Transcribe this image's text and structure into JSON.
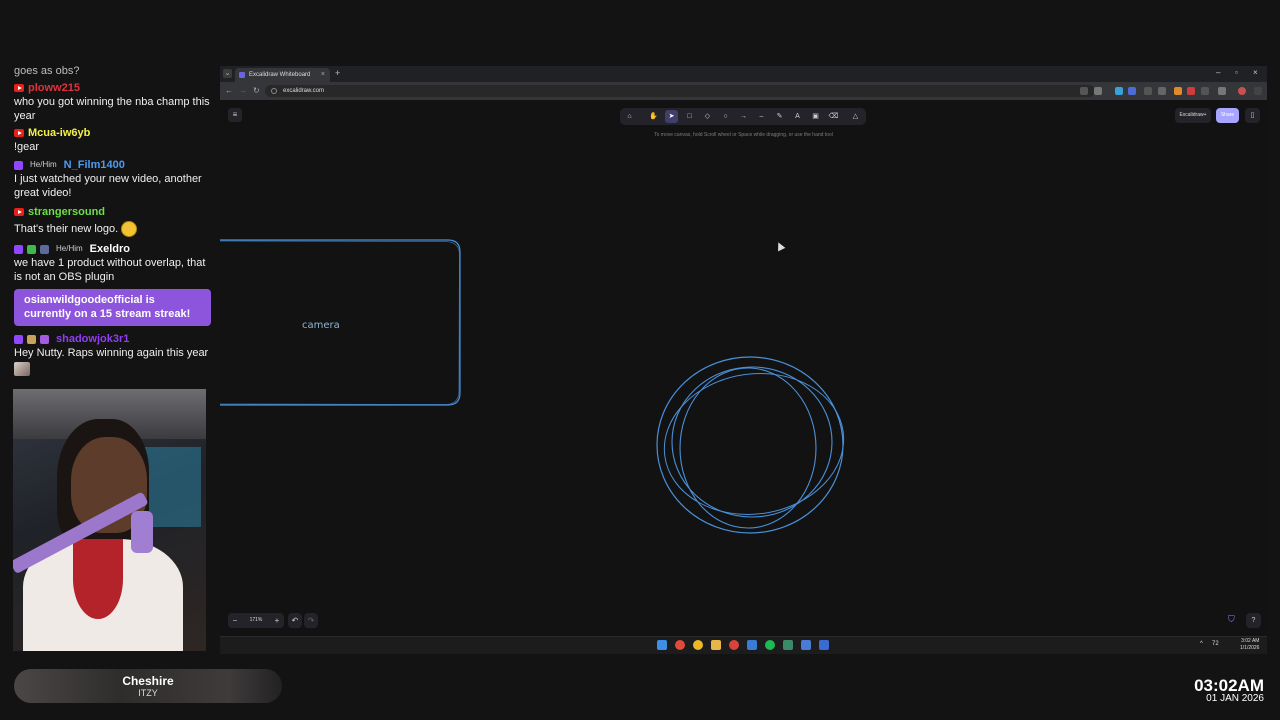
{
  "chat": {
    "partial_top": "goes as obs?",
    "messages": [
      {
        "platform": "youtube",
        "user": "ploww215",
        "color": "#e0323c",
        "text": "who you got winning the nba champ this year"
      },
      {
        "platform": "youtube",
        "user": "Mcua-iw6yb",
        "color": "#f2f24a",
        "text": "!gear"
      },
      {
        "platform": "twitch",
        "pronoun": "He/Him",
        "user": "N_Film1400",
        "color": "#4b9cf2",
        "text": "I just watched your new video, another great video!"
      },
      {
        "platform": "youtube",
        "user": "strangersound",
        "color": "#6ddf47",
        "text": "That's their new logo."
      },
      {
        "platform": "twitch",
        "pronoun": "He/Him",
        "user": "Exeldro",
        "color": "#ffffff",
        "text": "we have 1 product without overlap, that is not an OBS plugin"
      },
      {
        "platform": "twitch",
        "user": "shadowjok3r1",
        "color": "#8f3ff0",
        "text": "Hey Nutty. Raps winning again this year"
      }
    ],
    "streak_alert": "osianwildgoodeofficial is currently on a 15 stream streak!"
  },
  "now_playing": {
    "title": "Cheshire",
    "artist": "ITZY"
  },
  "stream_clock": {
    "time": "03:02AM",
    "date": "01 JAN 2026"
  },
  "browser": {
    "tab_title": "Excalidraw Whiteboard",
    "url": "excalidraw.com"
  },
  "excalidraw": {
    "tools": [
      "lock-icon",
      "hand-icon",
      "selection-icon",
      "rectangle-icon",
      "diamond-icon",
      "ellipse-icon",
      "arrow-icon",
      "line-icon",
      "draw-icon",
      "text-icon",
      "image-icon",
      "eraser-icon",
      "more-tools-icon"
    ],
    "active_tool": "selection-icon",
    "hint": "To move canvas, hold Scroll wheel or Space while dragging, or use the hand tool",
    "library_button": "Excalidraw+",
    "share_button": "Share",
    "camera_label": "camera",
    "zoom_level": "171%",
    "stroke_color": "#4a90d9"
  },
  "taskbar": {
    "temperature": "72",
    "time": "3:02 AM",
    "date": "1/1/2026"
  }
}
